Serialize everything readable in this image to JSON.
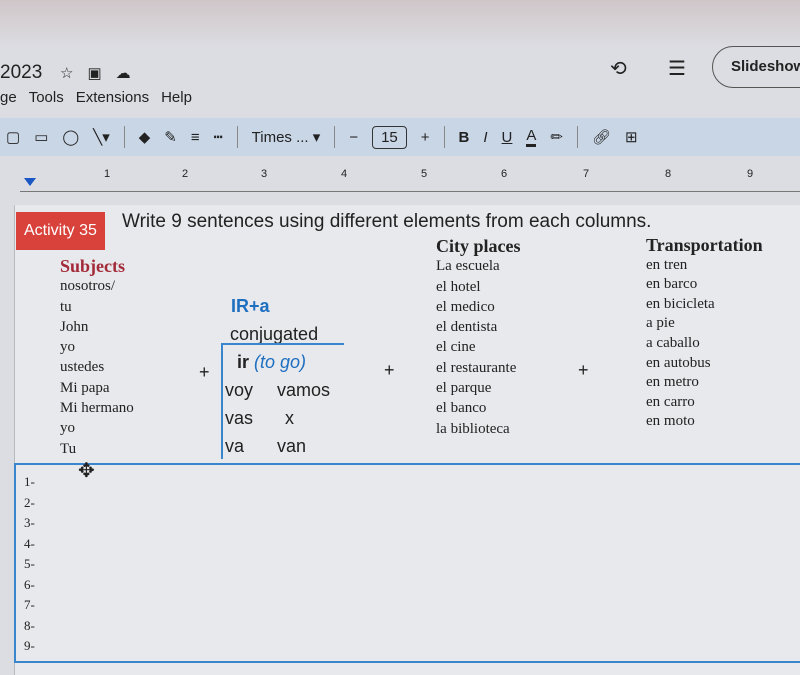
{
  "header": {
    "title": "2023",
    "slideshow": "Slideshow"
  },
  "menu": [
    "ge",
    "Tools",
    "Extensions",
    "Help"
  ],
  "toolbar": {
    "font": "Times ...",
    "font_size": "15",
    "minus": "−",
    "plus": "+",
    "bold": "B",
    "italic": "I",
    "underline": "U",
    "text_color": "A"
  },
  "ruler": [
    "1",
    "2",
    "3",
    "4",
    "5",
    "6",
    "7",
    "8",
    "9"
  ],
  "activity": {
    "badge": "Activity 35",
    "instruction": "Write 9 sentences using different elements from each columns."
  },
  "subjects": {
    "title": "Subjects",
    "items": [
      "nosotros/",
      "tu",
      "John",
      "yo",
      "ustedes",
      "Mi papa",
      "Mi hermano",
      "yo",
      "Tu"
    ]
  },
  "verb": {
    "title": "IR+a",
    "subtitle": "conjugated",
    "header": "ir",
    "header_note": "(to go)",
    "rows": [
      [
        "voy",
        "vamos"
      ],
      [
        "vas",
        "x"
      ],
      [
        "va",
        "van"
      ]
    ]
  },
  "places": {
    "title": "City places",
    "items": [
      "La escuela",
      "el hotel",
      "el medico",
      "el dentista",
      "el cine",
      "el restaurante",
      "el parque",
      "el banco",
      "la biblioteca"
    ]
  },
  "transport": {
    "title": "Transportation",
    "items": [
      "en tren",
      "en barco",
      "en bicicleta",
      "a pie",
      "a caballo",
      "en autobus",
      "en metro",
      "en carro",
      "en moto"
    ]
  },
  "plus_sign": "+",
  "numbers": [
    "1-",
    "2-",
    "3-",
    "4-",
    "5-",
    "6-",
    "7-",
    "8-",
    "9-"
  ]
}
